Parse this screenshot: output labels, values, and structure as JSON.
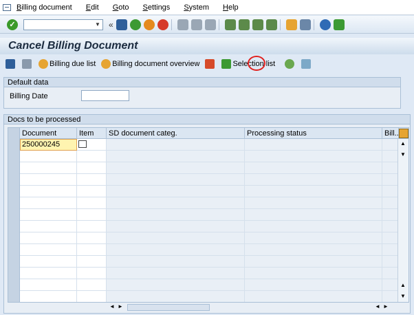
{
  "menu": [
    "Billing document",
    "Edit",
    "Goto",
    "Settings",
    "System",
    "Help"
  ],
  "title": "Cancel Billing Document",
  "app_toolbar": {
    "billing_due_list": "Billing due list",
    "billing_doc_overview": "Billing document overview",
    "selection_list": "Selection list"
  },
  "default_data": {
    "header": "Default data",
    "billing_date_label": "Billing Date",
    "billing_date_value": ""
  },
  "docs_table": {
    "header": "Docs to be processed",
    "columns": [
      "Document",
      "Item",
      "SD document categ.",
      "Processing status",
      "Bill..."
    ],
    "rows": [
      {
        "document": "250000245",
        "item": "",
        "categ": "",
        "status": ""
      }
    ]
  },
  "colors": {
    "accent": "#e0201e",
    "ok_green": "#3a9a2a"
  }
}
